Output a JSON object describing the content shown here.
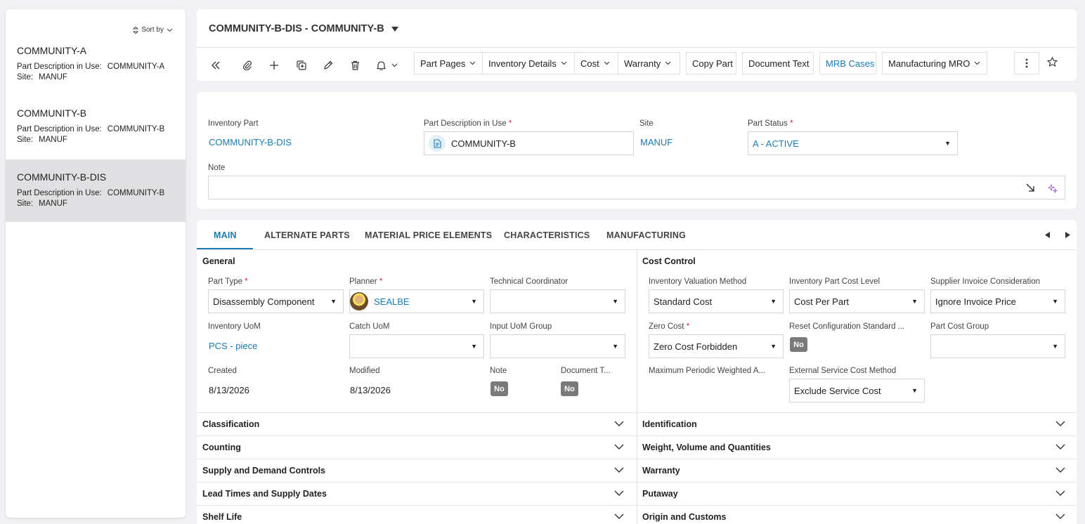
{
  "sidebar": {
    "sort_label": "Sort by",
    "items": [
      {
        "title": "COMMUNITY-A",
        "desc_label": "Part Description in Use:",
        "desc_value": "COMMUNITY-A",
        "site_label": "Site:",
        "site_value": "MANUF"
      },
      {
        "title": "COMMUNITY-B",
        "desc_label": "Part Description in Use:",
        "desc_value": "COMMUNITY-B",
        "site_label": "Site:",
        "site_value": "MANUF"
      },
      {
        "title": "COMMUNITY-B-DIS",
        "desc_label": "Part Description in Use:",
        "desc_value": "COMMUNITY-B",
        "site_label": "Site:",
        "site_value": "MANUF"
      }
    ]
  },
  "record": {
    "title": "COMMUNITY-B-DIS - COMMUNITY-B"
  },
  "toolbar": {
    "part_pages": "Part Pages",
    "inventory_details": "Inventory Details",
    "cost": "Cost",
    "warranty": "Warranty",
    "copy_part": "Copy Part",
    "document_text": "Document Text",
    "mrb_cases": "MRB Cases",
    "manufacturing_mro": "Manufacturing MRO"
  },
  "header": {
    "inventory_part_label": "Inventory Part",
    "inventory_part_value": "COMMUNITY-B-DIS",
    "part_desc_label": "Part Description in Use",
    "part_desc_value": "COMMUNITY-B",
    "site_label": "Site",
    "site_value": "MANUF",
    "part_status_label": "Part Status",
    "part_status_value": "A - ACTIVE",
    "note_label": "Note",
    "note_value": ""
  },
  "tabs": [
    "MAIN",
    "ALTERNATE PARTS",
    "MATERIAL PRICE ELEMENTS",
    "CHARACTERISTICS",
    "MANUFACTURING"
  ],
  "general": {
    "title": "General",
    "part_type_label": "Part Type",
    "part_type_value": "Disassembly Component",
    "planner_label": "Planner",
    "planner_value": "SEALBE",
    "tech_coord_label": "Technical Coordinator",
    "tech_coord_value": "",
    "inv_uom_label": "Inventory UoM",
    "inv_uom_value": "PCS - piece",
    "catch_uom_label": "Catch UoM",
    "catch_uom_value": "",
    "input_uom_label": "Input UoM Group",
    "input_uom_value": "",
    "created_label": "Created",
    "created_value": "8/13/2026",
    "modified_label": "Modified",
    "modified_value": "8/13/2026",
    "note_label": "Note",
    "note_value": "No",
    "doc_text_label": "Document T...",
    "doc_text_value": "No"
  },
  "cost_control": {
    "title": "Cost Control",
    "valuation_label": "Inventory Valuation Method",
    "valuation_value": "Standard Cost",
    "cost_level_label": "Inventory Part Cost Level",
    "cost_level_value": "Cost Per Part",
    "supplier_inv_label": "Supplier Invoice Consideration",
    "supplier_inv_value": "Ignore Invoice Price",
    "zero_cost_label": "Zero Cost",
    "zero_cost_value": "Zero Cost Forbidden",
    "reset_config_label": "Reset Configuration Standard ...",
    "reset_config_value": "No",
    "part_cost_group_label": "Part Cost Group",
    "part_cost_group_value": "",
    "max_periodic_label": "Maximum Periodic Weighted A...",
    "ext_service_label": "External Service Cost Method",
    "ext_service_value": "Exclude Service Cost"
  },
  "sections_left": [
    "Classification",
    "Counting",
    "Supply and Demand Controls",
    "Lead Times and Supply Dates",
    "Shelf Life"
  ],
  "sections_right": [
    "Identification",
    "Weight, Volume and Quantities",
    "Warranty",
    "Putaway",
    "Origin and Customs"
  ]
}
